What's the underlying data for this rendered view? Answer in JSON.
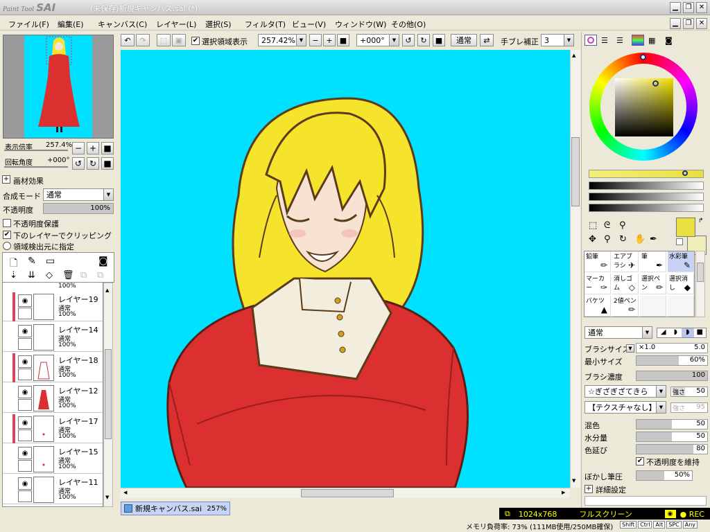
{
  "window": {
    "logo_small": "Paint Tool",
    "logo_big": "SAI",
    "title": "(未保存)新規キャンバス.sai (*)"
  },
  "menu": [
    "ファイル(F)",
    "編集(E)",
    "キャンバス(C)",
    "レイヤー(L)",
    "選択(S)",
    "フィルタ(T)",
    "ビュー(V)",
    "ウィンドウ(W)",
    "その他(O)"
  ],
  "toolbar": {
    "show_selection_label": "選択領域表示",
    "show_selection_checked": true,
    "zoom": "257.42%",
    "rotation": "+000°",
    "blend": "通常",
    "stabilizer_label": "手ブレ補正",
    "stabilizer_value": "3"
  },
  "navigator": {
    "zoom_label": "表示倍率",
    "zoom_value": "257.4%",
    "rotate_label": "回転角度",
    "rotate_value": "+000°"
  },
  "layer_props": {
    "effect_label": "画材効果",
    "blend_label": "合成モード",
    "blend_value": "通常",
    "opacity_label": "不透明度",
    "opacity_value": "100%",
    "opacity_fraction": 1.0,
    "protect_label": "不透明度保護",
    "protect_checked": false,
    "clip_label": "下のレイヤーでクリッピング",
    "clip_checked": true,
    "region_label": "領域検出元に指定"
  },
  "layer_list": {
    "partial_top": "100%",
    "items": [
      {
        "name": "レイヤー19",
        "mode": "通常",
        "opacity": "100%",
        "visible": true,
        "clip": true
      },
      {
        "name": "レイヤー14",
        "mode": "通常",
        "opacity": "100%",
        "visible": true,
        "clip": false
      },
      {
        "name": "レイヤー18",
        "mode": "通常",
        "opacity": "100%",
        "visible": true,
        "clip": true
      },
      {
        "name": "レイヤー12",
        "mode": "通常",
        "opacity": "100%",
        "visible": true,
        "clip": false
      },
      {
        "name": "レイヤー17",
        "mode": "通常",
        "opacity": "100%",
        "visible": true,
        "clip": true
      },
      {
        "name": "レイヤー15",
        "mode": "通常",
        "opacity": "100%",
        "visible": true,
        "clip": false
      },
      {
        "name": "レイヤー11",
        "mode": "通常",
        "opacity": "100%",
        "visible": true,
        "clip": false
      }
    ]
  },
  "canvas_tab": {
    "name": "新規キャンバス.sai",
    "zoom": "257%"
  },
  "tools": {
    "brushes": [
      "鉛筆",
      "エアブラシ",
      "筆",
      "水彩筆",
      "マーカー",
      "消しゴム",
      "選択ペン",
      "選択消し",
      "バケツ",
      "2値ペン"
    ],
    "active_brush": "水彩筆"
  },
  "brush_settings": {
    "blend_value": "通常",
    "size_label": "ブラシサイズ",
    "size_mult": "×1.0",
    "size_value": "5.0",
    "min_size_label": "最小サイズ",
    "min_size_value": "60%",
    "min_size_fraction": 0.6,
    "density_label": "ブラシ濃度",
    "density_value": "100",
    "density_fraction": 1.0,
    "shape_value": "☆ぎざぎざてきら",
    "shape_strength_label": "強さ",
    "shape_strength_value": "50",
    "texture_value": "【テクスチャなし】",
    "texture_strength_label": "強さ",
    "texture_strength_value": "95",
    "mix_label": "混色",
    "mix_value": "50",
    "mix_fraction": 0.5,
    "water_label": "水分量",
    "water_value": "50",
    "water_fraction": 0.5,
    "extend_label": "色延び",
    "extend_value": "80",
    "extend_fraction": 0.8,
    "keep_opacity_label": "不透明度を維持",
    "keep_opacity_checked": true,
    "blur_label": "ぼかし筆圧",
    "blur_value": "50%",
    "blur_fraction": 0.5,
    "detail_label": "詳細設定"
  },
  "colors": {
    "primary": "#e8e040",
    "secondary": "#f2eebc",
    "canvas_bg": "#00e0ff",
    "hair": "#f5e32c",
    "dress": "#dc2f2f",
    "skin": "#f8e3d2",
    "collar": "#f2eddc"
  },
  "recorder": {
    "size": "1024x768",
    "mode": "フルスクリーン",
    "rec": "REC"
  },
  "status": {
    "memory": "メモリ負荷率: 73% (111MB使用/250MB確保)",
    "keys": [
      "Shift",
      "Ctrl",
      "Alt",
      "SPC",
      "Any"
    ]
  }
}
